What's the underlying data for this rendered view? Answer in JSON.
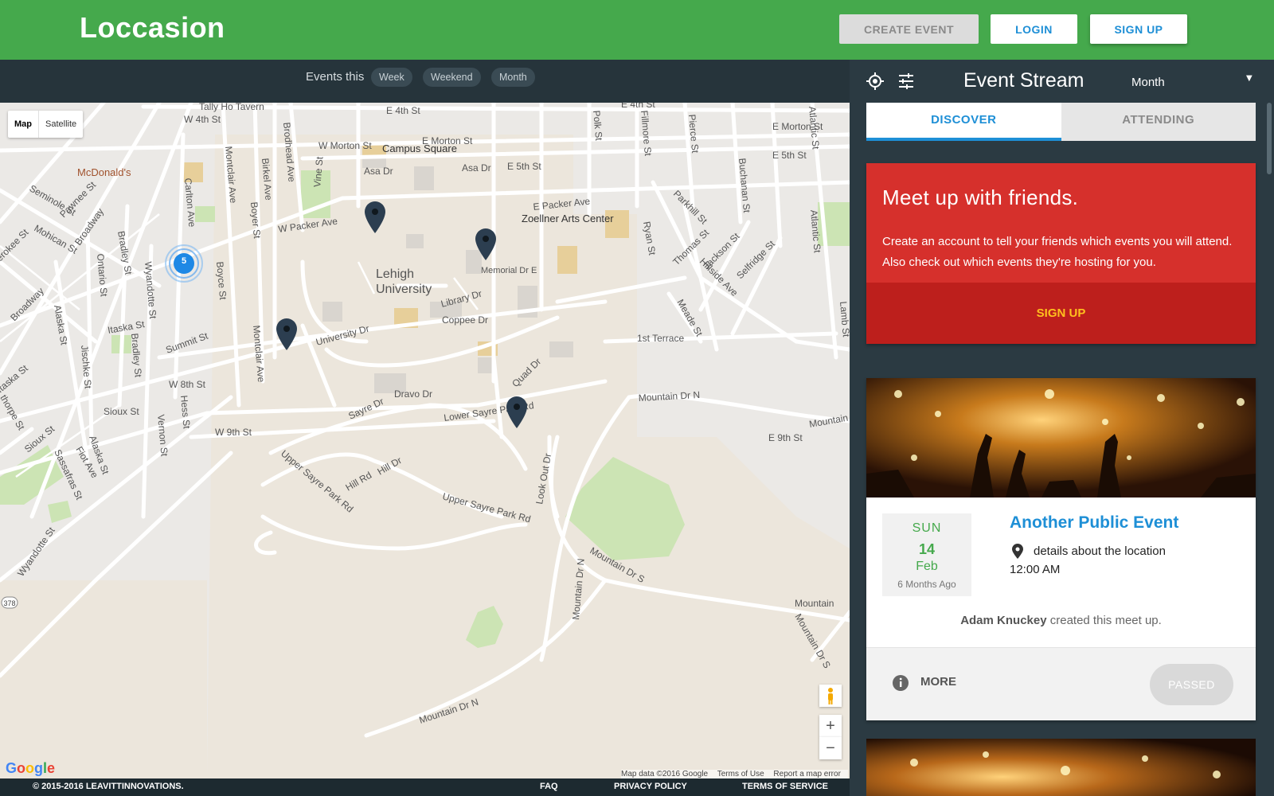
{
  "header": {
    "brand": "Loccasion",
    "create_event": "CREATE EVENT",
    "login": "LOGIN",
    "sign_up": "SIGN UP",
    "brand_color": "#45a94c"
  },
  "filter": {
    "label": "Events this",
    "options": [
      "Week",
      "Weekend",
      "Month"
    ]
  },
  "map": {
    "type_controls": [
      "Map",
      "Satellite"
    ],
    "active_type": "Map",
    "cluster_count": "5",
    "zoom_in": "+",
    "zoom_out": "−",
    "attribution": [
      "Map data ©2016 Google",
      "Terms of Use",
      "Report a map error"
    ],
    "logo_letters": [
      "G",
      "o",
      "o",
      "g",
      "l",
      "e"
    ],
    "labels": {
      "tally_ho": "Tally Ho Tavern",
      "w4th": "W 4th St",
      "e4th": "E 4th St",
      "e4th_b": "E 4th St",
      "e_morton": "E Morton St",
      "e_morton_b": "E Morton St",
      "w_morton": "W Morton St",
      "campus_square": "Campus Square",
      "asa_dr": "Asa Dr",
      "asa_dr_b": "Asa Dr",
      "e5th": "E 5th St",
      "e5th_b": "E 5th St",
      "polk": "Polk St",
      "fillmore": "Fillmore St",
      "pierce": "Pierce St",
      "buchanan": "Buchanan St",
      "atlantic": "Atlantic St",
      "atlantic_b": "Atlantic St",
      "mcdonalds": "McDonald's",
      "seminole": "Seminole St",
      "pawnee": "Pawnee St",
      "mohican": "Mohican St",
      "broadway": "Broadway",
      "broadway_b": "Broadway",
      "carlton": "Carlton Ave",
      "montclair": "Montclair Ave",
      "montclair_b": "Montclair Ave",
      "birkel": "Birkel Ave",
      "brodhead": "Brodhead Ave",
      "vine": "Vine St",
      "boyer": "Boyer St",
      "w_packer": "W Packer Ave",
      "e_packer": "E Packer Ave",
      "zoellner": "Zoellner Arts Center",
      "parkhill": "Parkhill St",
      "ryan": "Ryan St",
      "thomas": "Thomas St",
      "jackson": "Jackson St",
      "selfridge": "Selfridge St",
      "hillside": "Hillside Ave",
      "lehigh": "Lehigh",
      "university": "University",
      "memorial": "Memorial Dr E",
      "library": "Library Dr",
      "coppee": "Coppee Dr",
      "university_dr": "University Dr",
      "meade": "Meade St",
      "first_terrace": "1st Terrace",
      "lamb": "Lamb St",
      "bradley": "Bradley St",
      "bradley_b": "Bradley St",
      "ontario": "Ontario St",
      "wyandotte": "Wyandotte St",
      "wyandotte_b": "Wyandotte St",
      "boyce": "Boyce St",
      "itaska": "Itaska St",
      "itaska_b": "Itaska St",
      "summit": "Summit St",
      "alaska": "Alaska St",
      "alaska_b": "Alaska St",
      "jischke": "Jischke St",
      "w8th": "W 8th St",
      "hess": "Hess St",
      "sioux": "Sioux St",
      "sioux_b": "Sioux St",
      "vernon": "Vernon St",
      "w9th": "W 9th St",
      "sayre": "Sayre Dr",
      "dravo": "Dravo Dr",
      "quad": "Quad Dr",
      "lower_sayre": "Lower Sayre Park Rd",
      "mountain_n": "Mountain Dr N",
      "mountain_n_b": "Mountain Dr N",
      "mountain_n_c": "Mountain Dr N",
      "mountain_s": "Mountain Dr S",
      "mountain_s_b": "Mountain Dr S",
      "mountain_r": "Mountain",
      "mountain_r_b": "Mountain",
      "e9th": "E 9th St",
      "upper_sayre": "Upper Sayre Park Rd",
      "upper_sayre_b": "Upper Sayre Park Rd",
      "hill_rd": "Hill Rd",
      "hill_dr": "Hill Dr",
      "look_out": "Look Out Dr",
      "fiot": "Fiot Ave",
      "sassafras": "Sassafras St",
      "thorpe": "thorpe St",
      "erokee": "erokee St",
      "route": "378"
    }
  },
  "footer": {
    "copyright": "© 2015-2016 LEAVITTINNOVATIONS.",
    "faq": "FAQ",
    "privacy": "PRIVACY POLICY",
    "terms": "TERMS OF SERVICE"
  },
  "sidebar": {
    "title": "Event Stream",
    "range": "Month",
    "tabs": [
      "DISCOVER",
      "ATTENDING"
    ],
    "active_tab": "DISCOVER",
    "promo": {
      "heading": "Meet up with friends.",
      "body": "Create an account to tell your friends which events you will attend. Also check out which events they're hosting for you.",
      "cta": "SIGN UP",
      "color": "#d6302c"
    },
    "event": {
      "dow": "SUN",
      "day": "14",
      "month": "Feb",
      "ago": "6 Months Ago",
      "title": "Another Public Event",
      "location": "details about the location",
      "time": "12:00 AM",
      "creator_name": "Adam Knuckey",
      "creator_suffix": "created this meet up.",
      "more": "MORE",
      "status": "PASSED"
    }
  }
}
